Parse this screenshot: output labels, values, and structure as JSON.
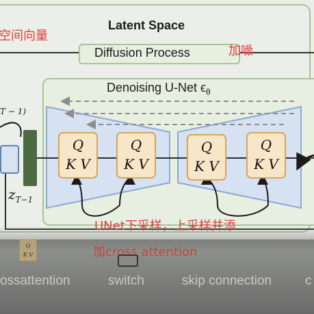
{
  "latent_space": {
    "title": "Latent Space",
    "note_left": "空间向量",
    "note_right": "加噪",
    "process_label": "Diffusion Process"
  },
  "unet": {
    "title": "Denoising U-Net ϵ",
    "title_sub": "θ",
    "block_q": "Q",
    "block_kv": "K V",
    "note_sampling": "UNet下采样，上采样并添",
    "note_cross": "加cross attention"
  },
  "latent_var": {
    "main": "z",
    "sub": "T−1",
    "top_fragment": "T − 1)"
  },
  "legend": {
    "mini_q": "Q",
    "mini_kv": "K V",
    "crossattention": "ossattention",
    "switch": "switch",
    "skip": "skip connection",
    "last": "c"
  },
  "colors": {
    "frame_green": "#a9c49a",
    "unet_blue": "#8fa8d4",
    "block_fill": "#f8e6c8",
    "block_border": "#d8a45a",
    "note_red": "#d8403a"
  }
}
